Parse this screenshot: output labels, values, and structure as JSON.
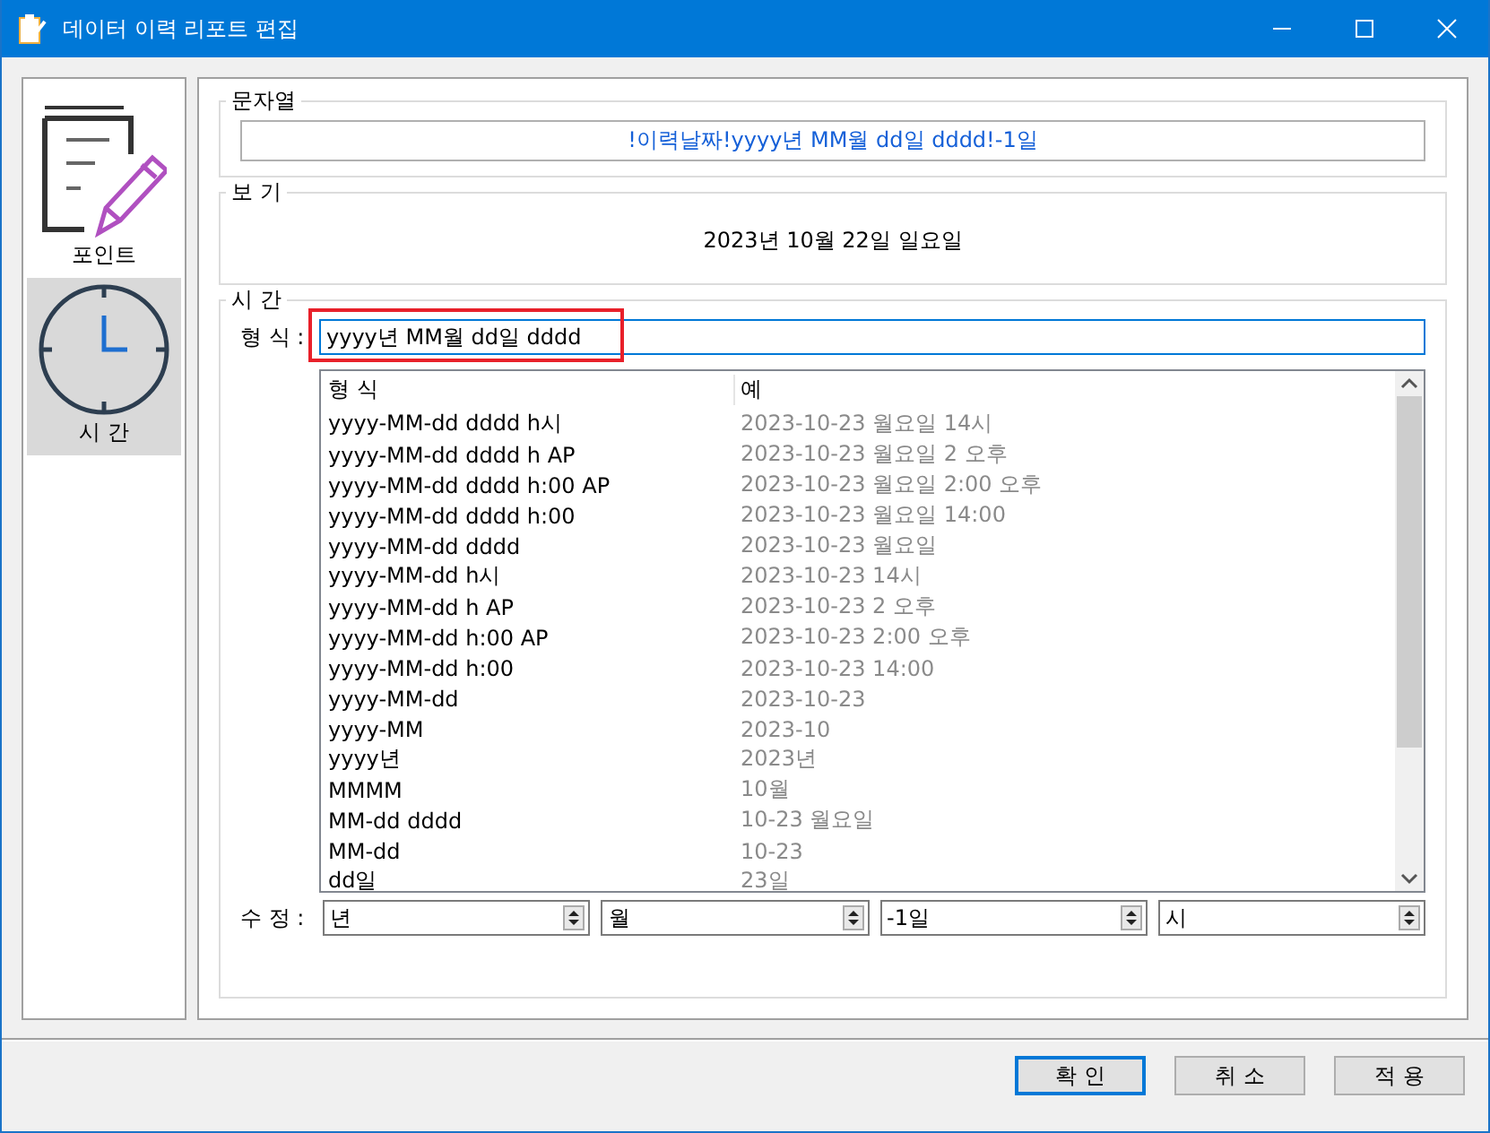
{
  "window": {
    "title": "데이터 이력 리포트 편집"
  },
  "sidebar": {
    "items": [
      {
        "label": "포인트",
        "kind": "document",
        "selected": false
      },
      {
        "label": "시 간",
        "kind": "clock",
        "selected": true
      }
    ]
  },
  "string_group": {
    "title": "문자열",
    "value": "!이력날짜!yyyy년 MM월 dd일 dddd!-1일"
  },
  "preview_group": {
    "title": "보 기",
    "value": "2023년 10월 22일 일요일"
  },
  "time_group": {
    "title": "시 간",
    "format_label": "형 식 :",
    "format_value": "yyyy년 MM월 dd일 dddd",
    "highlighted": true,
    "table": {
      "columns": [
        "형 식",
        "예"
      ],
      "rows": [
        [
          "yyyy-MM-dd dddd h시",
          "2023-10-23 월요일 14시"
        ],
        [
          "yyyy-MM-dd dddd h AP",
          "2023-10-23 월요일 2 오후"
        ],
        [
          "yyyy-MM-dd dddd h:00 AP",
          "2023-10-23 월요일 2:00 오후"
        ],
        [
          "yyyy-MM-dd dddd h:00",
          "2023-10-23 월요일 14:00"
        ],
        [
          "yyyy-MM-dd dddd",
          "2023-10-23 월요일"
        ],
        [
          "yyyy-MM-dd h시",
          "2023-10-23 14시"
        ],
        [
          "yyyy-MM-dd h AP",
          "2023-10-23 2 오후"
        ],
        [
          "yyyy-MM-dd h:00 AP",
          "2023-10-23 2:00 오후"
        ],
        [
          "yyyy-MM-dd h:00",
          "2023-10-23 14:00"
        ],
        [
          "yyyy-MM-dd",
          "2023-10-23"
        ],
        [
          "yyyy-MM",
          "2023-10"
        ],
        [
          "yyyy년",
          "2023년"
        ],
        [
          "MMMM",
          "10월"
        ],
        [
          "MM-dd dddd",
          "10-23 월요일"
        ],
        [
          "MM-dd",
          "10-23"
        ],
        [
          "dd일",
          "23일"
        ]
      ]
    },
    "adjust_label": "수 정 :",
    "spinners": [
      "년",
      "월",
      "-1일",
      "시"
    ]
  },
  "buttons": [
    {
      "label": "확 인",
      "default": true
    },
    {
      "label": "취 소",
      "default": false
    },
    {
      "label": "적 용",
      "default": false
    }
  ]
}
